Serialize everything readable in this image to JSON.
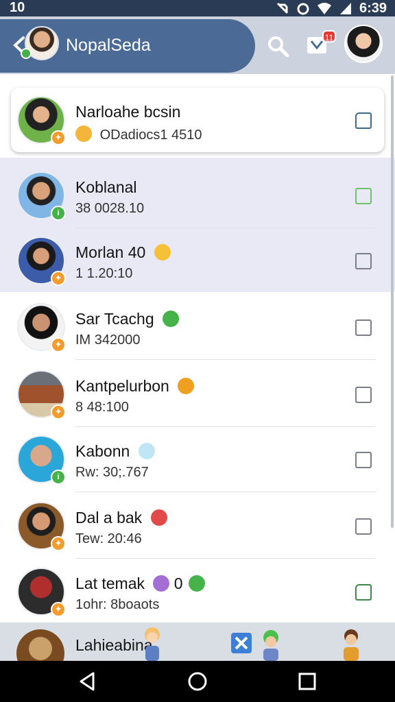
{
  "status": {
    "left": "10",
    "clock": "6:39"
  },
  "header": {
    "title": "NopalSeda",
    "inbox_badge": "11"
  },
  "contacts": [
    {
      "name": "Narloahe bcsin",
      "sub": "ODadiocs1 4510",
      "sub_emoji_color": "#f3b63a",
      "badge_color": "#f39c2b"
    },
    {
      "name": "Koblanal",
      "sub": "38 0028.10",
      "badge_color": "#46b34a"
    },
    {
      "name": "Morlan 40",
      "sub": "1 1.20:10",
      "name_emoji_color": "#f6c136",
      "badge_color": "#f39c2b"
    },
    {
      "name": "Sar Tcachg",
      "sub": "IM 342000",
      "name_emoji_color": "#46b34a",
      "badge_color": "#f39c2b"
    },
    {
      "name": "Kantpelurbon",
      "sub": "8 48:100",
      "name_emoji_color": "#f0a020",
      "badge_color": "#f39c2b"
    },
    {
      "name": "Kabonn",
      "sub": "Rw: 30;.767",
      "name_emoji_color": "#bfe6f5",
      "badge_color": "#46b34a"
    },
    {
      "name": "Dal a bak",
      "sub": "Tew: 20:46",
      "name_emoji_color": "#e24a4a",
      "badge_color": "#f39c2b"
    },
    {
      "name": "Lat temak",
      "sub": "1ohr: 8boaots",
      "name_emoji_color": "#a36ed6",
      "badge_color": "#f39c2b",
      "name_suffix": "0"
    }
  ],
  "bottom_item": {
    "name": "Lahieabina"
  },
  "colors": {
    "appbar": "#4b6a96",
    "status": "#2a3b55",
    "highlight": "#e8e9f4"
  }
}
